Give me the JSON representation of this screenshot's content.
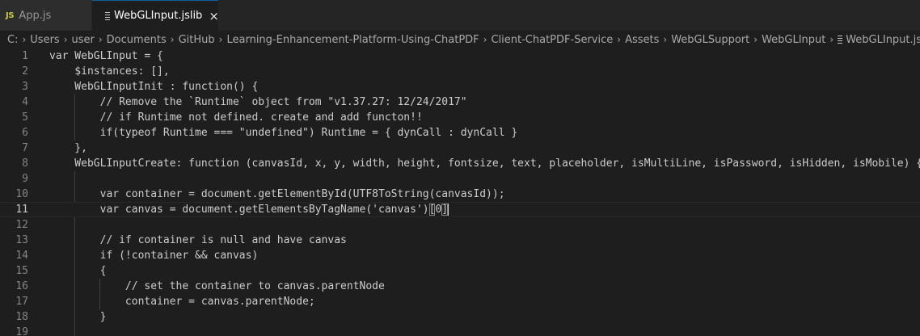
{
  "tabs": [
    {
      "badge": "JS",
      "label": "App.js",
      "active": false
    },
    {
      "label": "WebGLInput.jslib",
      "active": true,
      "close_glyph": "×"
    }
  ],
  "breadcrumb": {
    "items": [
      "C:",
      "Users",
      "user",
      "Documents",
      "GitHub",
      "Learning-Enhancement-Platform-Using-ChatPDF",
      "Client-ChatPDF-Service",
      "Assets",
      "WebGLSupport",
      "WebGLInput"
    ],
    "file": "WebGLInput.jslib",
    "separator": "›"
  },
  "editor": {
    "current_line": 11,
    "lines": [
      {
        "num": "1",
        "text": "var WebGLInput = {"
      },
      {
        "num": "2",
        "text": "    $instances: [],"
      },
      {
        "num": "3",
        "text": "    WebGLInputInit : function() {"
      },
      {
        "num": "4",
        "text": "        // Remove the `Runtime` object from \"v1.37.27: 12/24/2017\""
      },
      {
        "num": "5",
        "text": "        // if Runtime not defined. create and add functon!!"
      },
      {
        "num": "6",
        "text": "        if(typeof Runtime === \"undefined\") Runtime = { dynCall : dynCall }"
      },
      {
        "num": "7",
        "text": "    },"
      },
      {
        "num": "8",
        "text": "    WebGLInputCreate: function (canvasId, x, y, width, height, fontsize, text, placeholder, isMultiLine, isPassword, isHidden, isMobile) {"
      },
      {
        "num": "9",
        "text": ""
      },
      {
        "num": "10",
        "text": "        var container = document.getElementById(UTF8ToString(canvasId));"
      },
      {
        "num": "11",
        "text": "        var canvas = document.getElementsByTagName('canvas')",
        "bracket_open": "[",
        "bracket_inner": "0",
        "bracket_close": "]"
      },
      {
        "num": "12",
        "text": ""
      },
      {
        "num": "13",
        "text": "        // if container is null and have canvas"
      },
      {
        "num": "14",
        "text": "        if (!container && canvas)"
      },
      {
        "num": "15",
        "text": "        {"
      },
      {
        "num": "16",
        "text": "            // set the container to canvas.parentNode"
      },
      {
        "num": "17",
        "text": "            container = canvas.parentNode;"
      },
      {
        "num": "18",
        "text": "        }"
      },
      {
        "num": "19",
        "text": ""
      }
    ]
  },
  "colors": {
    "background": "#1e1e1e",
    "tabbar": "#252526",
    "text": "#cccccc",
    "line_number": "#858585",
    "js_badge": "#cbcb41"
  }
}
